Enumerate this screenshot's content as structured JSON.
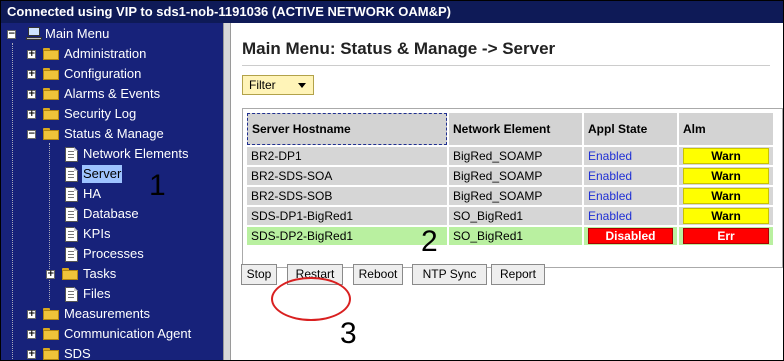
{
  "window": {
    "title": "Connected using VIP to sds1-nob-1191036 (ACTIVE NETWORK OAM&P)"
  },
  "sidebar": {
    "root": "Main Menu",
    "items": [
      "Administration",
      "Configuration",
      "Alarms & Events",
      "Security Log",
      "Status & Manage",
      "Network Elements",
      "Server",
      "HA",
      "Database",
      "KPIs",
      "Processes",
      "Tasks",
      "Files",
      "Measurements",
      "Communication Agent",
      "SDS"
    ]
  },
  "main": {
    "title": "Main Menu: Status & Manage -> Server",
    "filter_label": "Filter",
    "columns": [
      "Server Hostname",
      "Network Element",
      "Appl State",
      "Alm"
    ],
    "rows": [
      {
        "hostname": "BR2-DP1",
        "ne": "BigRed_SOAMP",
        "appl": "Enabled",
        "alm": "Warn"
      },
      {
        "hostname": "BR2-SDS-SOA",
        "ne": "BigRed_SOAMP",
        "appl": "Enabled",
        "alm": "Warn"
      },
      {
        "hostname": "BR2-SDS-SOB",
        "ne": "BigRed_SOAMP",
        "appl": "Enabled",
        "alm": "Warn"
      },
      {
        "hostname": "SDS-DP1-BigRed1",
        "ne": "SO_BigRed1",
        "appl": "Enabled",
        "alm": "Warn"
      },
      {
        "hostname": "SDS-DP2-BigRed1",
        "ne": "SO_BigRed1",
        "appl": "Disabled",
        "alm": "Err"
      }
    ],
    "buttons": {
      "stop": "Stop",
      "restart": "Restart",
      "reboot": "Reboot",
      "ntp_sync": "NTP Sync",
      "report": "Report"
    }
  },
  "annotations": [
    "1",
    "2",
    "3"
  ],
  "colors": {
    "sidebar_bg": "#17227a",
    "topbar_bg": "#0e1a57",
    "warn": "#ffff00",
    "err": "#ff0000",
    "selected_row": "#b9f0a0",
    "annotation_circle": "#d92020"
  }
}
